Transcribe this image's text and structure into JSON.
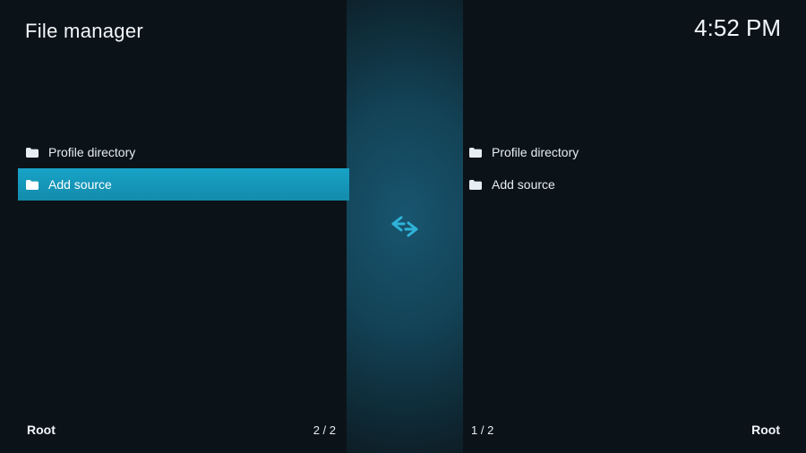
{
  "header": {
    "title": "File manager",
    "time": "4:52 PM"
  },
  "panes": {
    "left": {
      "items": [
        {
          "label": "Profile directory",
          "icon": "folder-icon",
          "selected": false
        },
        {
          "label": "Add source",
          "icon": "folder-icon",
          "selected": true
        }
      ],
      "path_label": "Root",
      "count": "2 / 2"
    },
    "right": {
      "items": [
        {
          "label": "Profile directory",
          "icon": "folder-icon",
          "selected": false
        },
        {
          "label": "Add source",
          "icon": "folder-icon",
          "selected": false
        }
      ],
      "path_label": "Root",
      "count": "1 / 2"
    }
  },
  "center_icon": "swap-arrows-icon",
  "colors": {
    "accent": "#17a3c7",
    "bg": "#0c1318"
  }
}
